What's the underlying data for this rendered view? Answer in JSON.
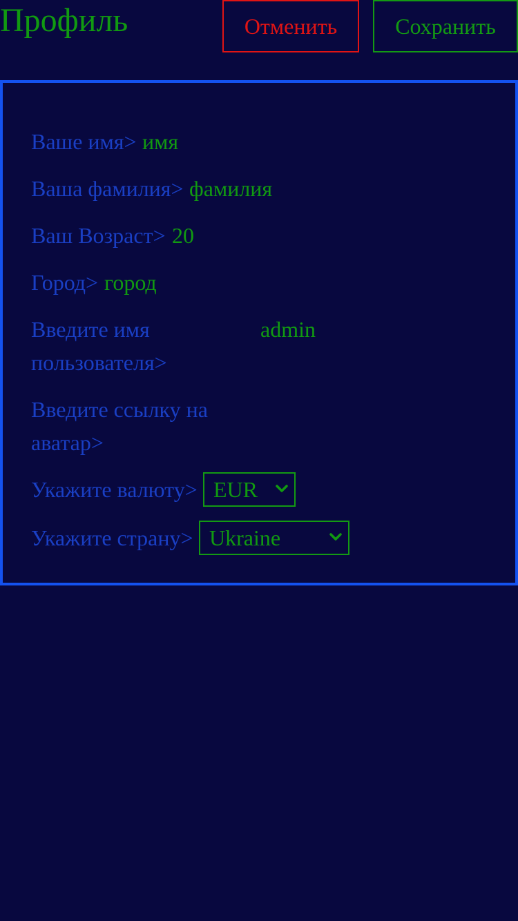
{
  "header": {
    "title": "Профиль",
    "cancel_label": "Отменить",
    "save_label": "Сохранить"
  },
  "form": {
    "first_name": {
      "label": "Ваше имя>",
      "value": "имя"
    },
    "last_name": {
      "label": "Ваша фамилия>",
      "value": "фамилия"
    },
    "age": {
      "label": "Ваш Возраст>",
      "value": "20"
    },
    "city": {
      "label": "Город>",
      "value": "город"
    },
    "username": {
      "label_line1": "Введите имя",
      "label_line2": "пользователя>",
      "value": "admin"
    },
    "avatar": {
      "label_line1": "Введите ссылку на",
      "label_line2": "аватар>",
      "value": ""
    },
    "currency": {
      "label": "Укажите валюту>",
      "selected": "EUR"
    },
    "country": {
      "label": "Укажите страну>",
      "selected": "Ukraine"
    }
  },
  "colors": {
    "background": "#08083f",
    "label": "#1a3fc4",
    "value": "#119a11",
    "cancel": "#e01414",
    "panel_border": "#1452f0"
  },
  "icons": {
    "select_arrow": "chevron-down-icon"
  }
}
